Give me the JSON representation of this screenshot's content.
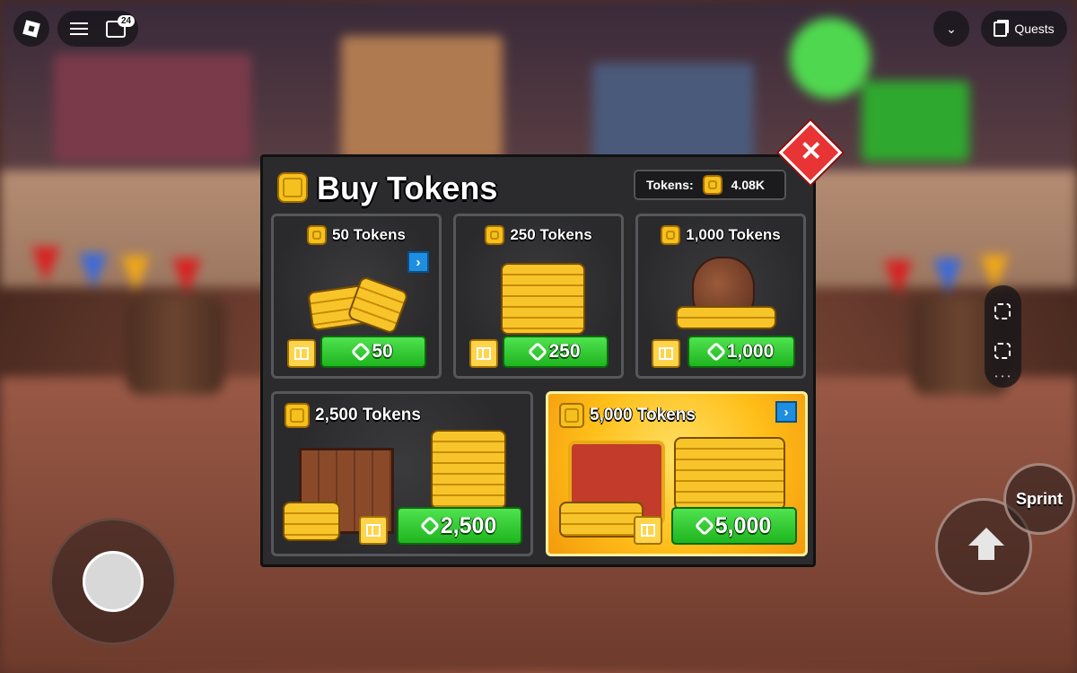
{
  "topbar": {
    "chat_badge": "24",
    "quests_label": "Quests"
  },
  "shop": {
    "title": "Buy Tokens",
    "balance_label": "Tokens:",
    "balance_value": "4.08K",
    "close_label": "✕",
    "items": [
      {
        "name": "50 Tokens",
        "price": "50"
      },
      {
        "name": "250 Tokens",
        "price": "250"
      },
      {
        "name": "1,000 Tokens",
        "price": "1,000"
      },
      {
        "name": "2,500 Tokens",
        "price": "2,500"
      },
      {
        "name": "5,000 Tokens",
        "price": "5,000"
      }
    ]
  },
  "controls": {
    "sprint_label": "Sprint"
  },
  "colors": {
    "price_green": "#2fd12f",
    "close_red": "#e83434",
    "coin_gold": "#f5c11e",
    "featured_gold": "#ffbf1a"
  },
  "icons": [
    "roblox-logo-icon",
    "menu-icon",
    "chat-icon",
    "chevron-down-icon",
    "quests-icon",
    "screenshot-icon",
    "capture-icon",
    "coin-icon",
    "robux-icon",
    "gift-icon",
    "arrow-right-icon",
    "close-icon",
    "jump-arrow-icon"
  ]
}
